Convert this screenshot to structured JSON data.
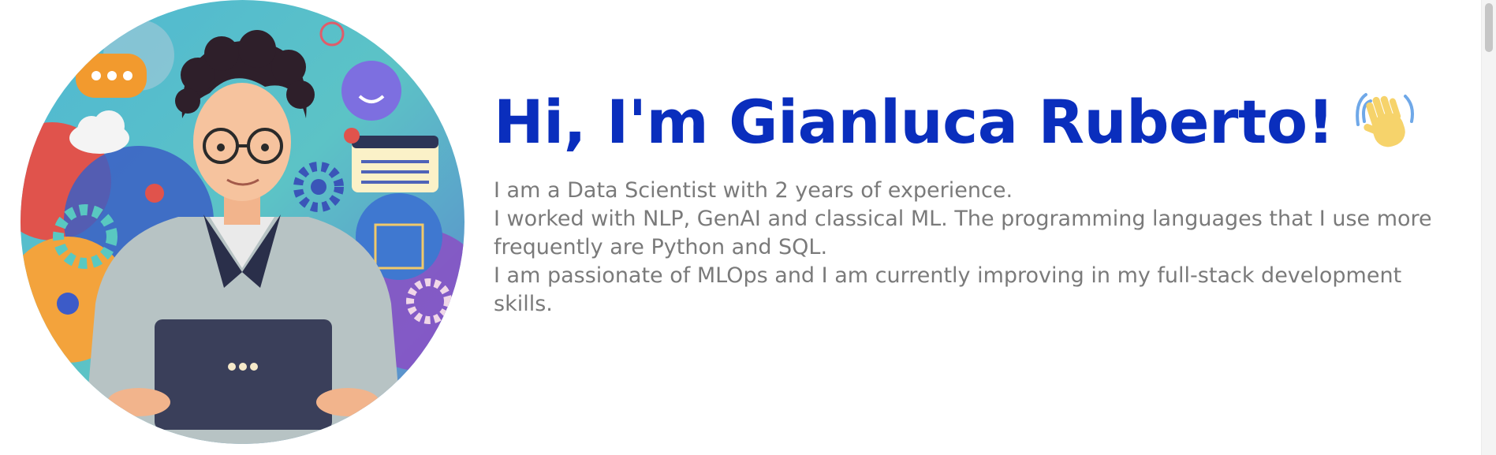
{
  "hero": {
    "title": "Hi, I'm Gianluca Ruberto!",
    "wave_icon": "waving-hand-emoji",
    "avatar_icon": "developer-avatar-illustration",
    "bio": [
      "I am a Data Scientist with 2 years of experience.",
      "I worked with NLP, GenAI and classical ML. The programming languages that I use more frequently are Python and SQL.",
      "I am passionate of MLOps and I am currently improving in my full-stack development skills."
    ]
  },
  "colors": {
    "title": "#0a2ebd",
    "bio_text": "#7a7a7a",
    "background": "#ffffff"
  }
}
